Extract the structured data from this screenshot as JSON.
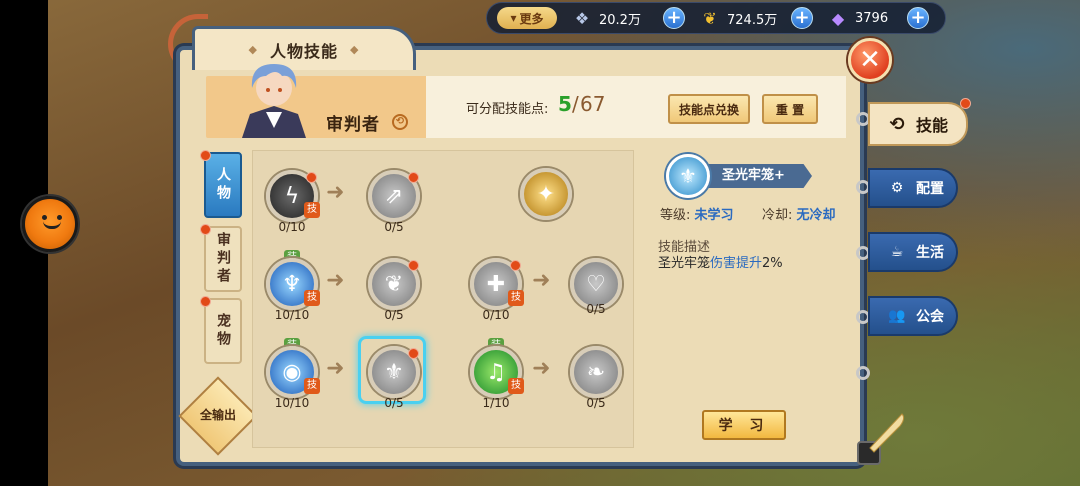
{
  "topbar": {
    "more_label": "更多",
    "currencies": [
      {
        "icon": "feather-gem-icon",
        "value": "20.2万"
      },
      {
        "icon": "gold-leaf-icon",
        "value": "724.5万"
      },
      {
        "icon": "crystal-diamond-icon",
        "value": "3796"
      }
    ]
  },
  "panel": {
    "title": "人物技能",
    "character_name": "审判者",
    "points_label": "可分配技能点:",
    "points_current": "5",
    "points_separator": "/",
    "points_max": "67",
    "exchange_button": "技能点兑换",
    "reset_button": "重 置"
  },
  "side_tabs": [
    {
      "label": "人物",
      "active": true
    },
    {
      "label": "审判者",
      "active": false
    },
    {
      "label": "宠物",
      "active": false
    }
  ],
  "all_output_label": "全输出",
  "skills": {
    "r1c1": {
      "count": "0/10",
      "tag": "技"
    },
    "r1c2": {
      "count": "0/5"
    },
    "r2c1": {
      "count": "10/10",
      "tag": "技",
      "equip": "装"
    },
    "r2c2": {
      "count": "0/5"
    },
    "r2c3": {
      "count": "0/10",
      "tag": "技"
    },
    "r2c4": {
      "count": "0/5"
    },
    "r3c1": {
      "count": "10/10",
      "tag": "技",
      "equip": "装"
    },
    "r3c2": {
      "count": "0/5"
    },
    "r3c3": {
      "count": "1/10",
      "tag": "技",
      "equip": "装"
    },
    "r3c4": {
      "count": "0/5"
    }
  },
  "detail": {
    "skill_name": "圣光牢笼+",
    "level_label": "等级:",
    "level_value": "未学习",
    "cooldown_label": "冷却:",
    "cooldown_value": "无冷却",
    "desc_heading": "技能描述",
    "desc_prefix": "圣光牢笼",
    "desc_highlight": "伤害提升",
    "desc_suffix": "2%",
    "learn_button": "学 习"
  },
  "right_nav": [
    {
      "label": "技能",
      "icon": "skill-swirl-icon",
      "active": true
    },
    {
      "label": "配置",
      "icon": "gear-icon",
      "active": false
    },
    {
      "label": "生活",
      "icon": "cup-icon",
      "active": false
    },
    {
      "label": "公会",
      "icon": "people-icon",
      "active": false
    }
  ],
  "colors": {
    "accent_blue": "#2a7ac0",
    "alert_red": "#e24a18",
    "points_green": "#2aa02a"
  }
}
